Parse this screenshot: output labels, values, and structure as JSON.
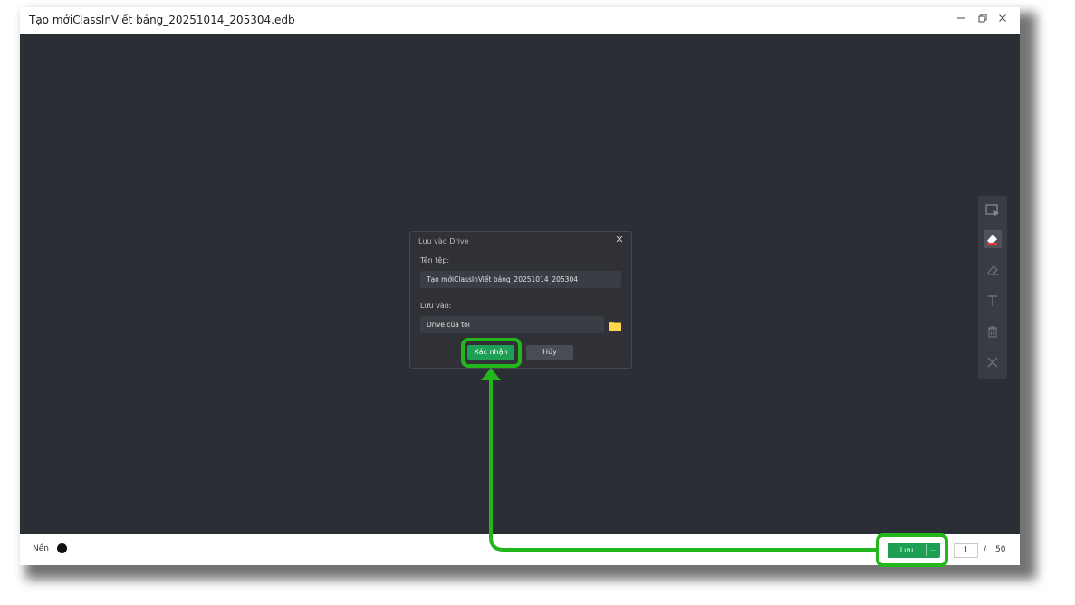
{
  "window": {
    "title": "Tạo mớiClassInViết bảng_20251014_205304.edb",
    "minimize_icon": "minimize-icon",
    "restore_icon": "restore-icon",
    "close_icon": "close-icon"
  },
  "toolbar": {
    "tools": [
      {
        "name": "select-tool",
        "icon": "select-cursor-icon",
        "active": false
      },
      {
        "name": "pen-tool",
        "icon": "pen-icon",
        "active": true
      },
      {
        "name": "eraser-tool",
        "icon": "eraser-icon",
        "active": false
      },
      {
        "name": "text-tool",
        "icon": "text-icon",
        "active": false
      },
      {
        "name": "delete-tool",
        "icon": "trash-icon",
        "active": false
      },
      {
        "name": "clear-tool",
        "icon": "clear-icon",
        "active": false
      }
    ]
  },
  "dialog": {
    "title": "Lưu vào Drive",
    "filename_label": "Tên tệp:",
    "filename_value": "Tạo mớiClassInViết bảng_20251014_205304",
    "location_label": "Lưu vào:",
    "location_value": "Drive của tôi",
    "confirm_label": "Xác nhận",
    "cancel_label": "Hủy"
  },
  "bottombar": {
    "background_label": "Nền",
    "background_color": "#111111",
    "save_label": "Lưu",
    "save_more_label": "...",
    "current_page": "1",
    "page_separator": "/",
    "total_pages": "50"
  },
  "colors": {
    "canvas": "#2c2e35",
    "accent_green": "#1d9f54",
    "highlight_green": "#22b61c"
  }
}
